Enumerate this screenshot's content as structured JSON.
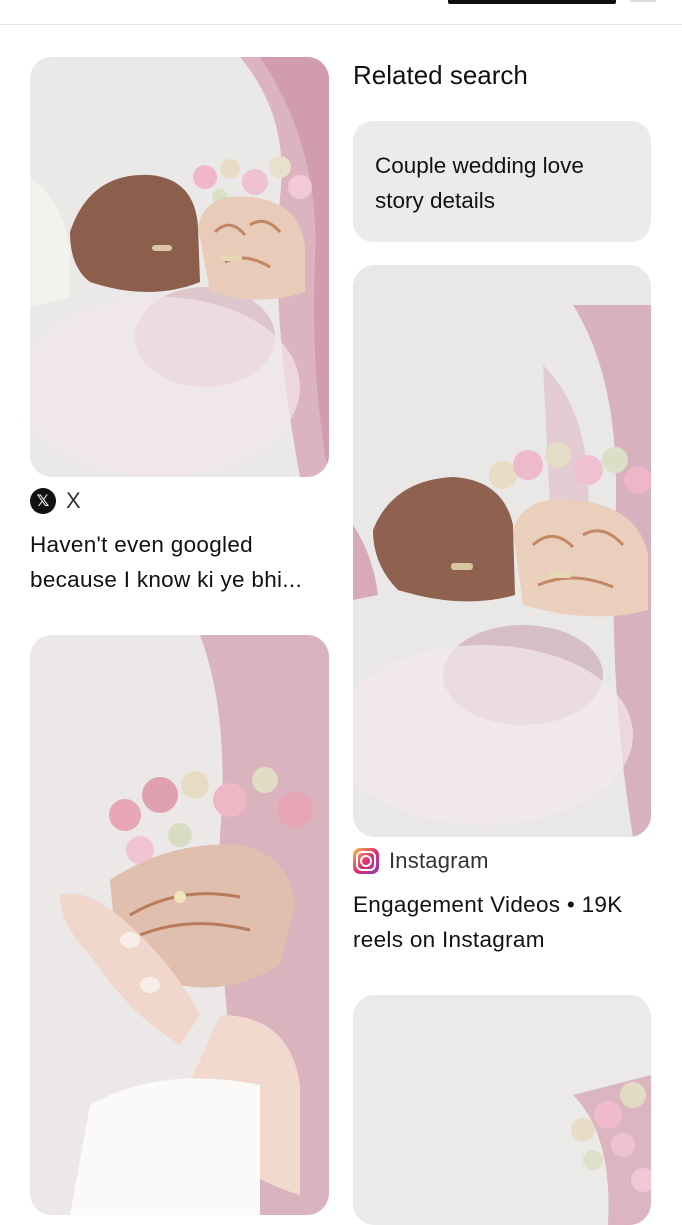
{
  "related": {
    "title": "Related search",
    "card_text": "Couple wedding love story details"
  },
  "pins": [
    {
      "image_icon": "rings-fists-photo",
      "source_icon": "x-logo-icon",
      "source_name": "X",
      "caption_line1": "Haven't even googled",
      "caption_line2": "because I know ki ye bhi..."
    },
    {
      "image_icon": "holding-hands-ring-photo"
    },
    {
      "image_icon": "rings-fists-photo",
      "source_icon": "instagram-logo-icon",
      "source_name": "Instagram",
      "caption_line1": "Engagement Videos • 19K",
      "caption_line2": "reels on Instagram"
    },
    {
      "image_icon": "flowers-veil-photo"
    }
  ],
  "colors": {
    "card_bg": "#eaebed",
    "text": "#111111",
    "veil_pink": "#d9a9b6"
  }
}
